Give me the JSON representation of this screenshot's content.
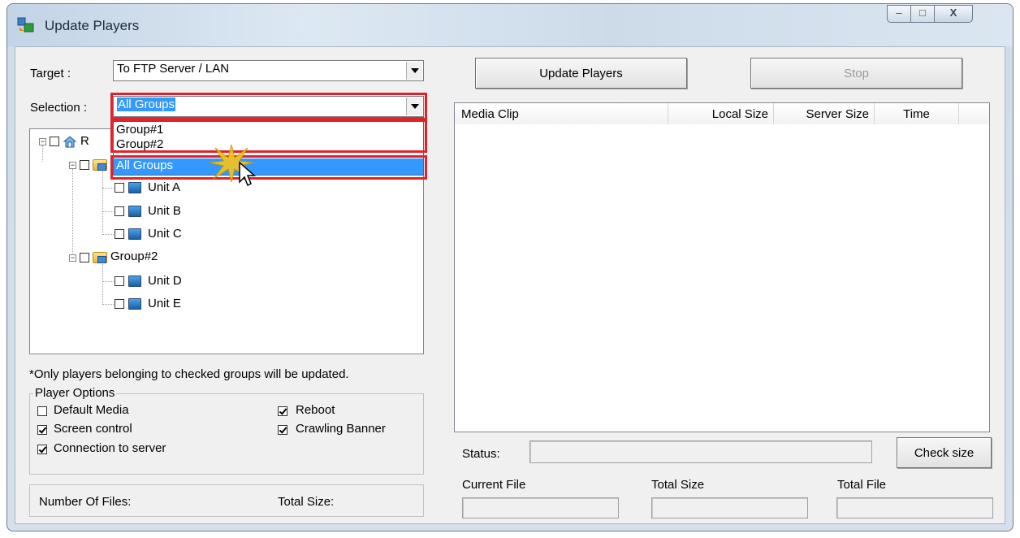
{
  "window": {
    "title": "Update Players",
    "controls": {
      "minimize": "–",
      "maximize": "□",
      "close": "X"
    }
  },
  "target": {
    "label": "Target :",
    "value": "To FTP Server / LAN"
  },
  "selection": {
    "label": "Selection :",
    "value": "All Groups",
    "options": [
      "Group#1",
      "Group#2",
      "All Groups"
    ],
    "highlighted": "All Groups"
  },
  "tree": {
    "root_label": "R",
    "groups": [
      {
        "label": "",
        "checked": false,
        "units": [
          {
            "label": "Unit A",
            "checked": false
          },
          {
            "label": "Unit B",
            "checked": false
          },
          {
            "label": "Unit C",
            "checked": false
          }
        ]
      },
      {
        "label": "Group#2",
        "checked": false,
        "units": [
          {
            "label": "Unit D",
            "checked": false
          },
          {
            "label": "Unit E",
            "checked": false
          }
        ]
      }
    ]
  },
  "note": "*Only players belonging to checked groups will be updated.",
  "player_options": {
    "title": "Player Options",
    "default_media": {
      "label": "Default Media",
      "checked": false
    },
    "screen_control": {
      "label": "Screen control",
      "checked": true
    },
    "connection_to_server": {
      "label": "Connection to server",
      "checked": true
    },
    "reboot": {
      "label": "Reboot",
      "checked": true
    },
    "crawling_banner": {
      "label": "Crawling Banner",
      "checked": true
    }
  },
  "summary": {
    "files_label": "Number Of Files:",
    "size_label": "Total Size:"
  },
  "buttons": {
    "update": "Update Players",
    "stop": "Stop",
    "check_size": "Check size"
  },
  "list": {
    "columns": [
      "Media Clip",
      "Local Size",
      "Server Size",
      "Time"
    ]
  },
  "status": {
    "label": "Status:",
    "current_file_label": "Current File",
    "total_size_label": "Total Size",
    "total_file_label": "Total File"
  },
  "colors": {
    "highlight": "#3399ff",
    "callout": "#e0232b",
    "burst": "#f5c518"
  },
  "icons": [
    "app-icon",
    "home-icon",
    "folder-icon",
    "monitor-icon",
    "cursor-icon",
    "click-burst-icon"
  ]
}
